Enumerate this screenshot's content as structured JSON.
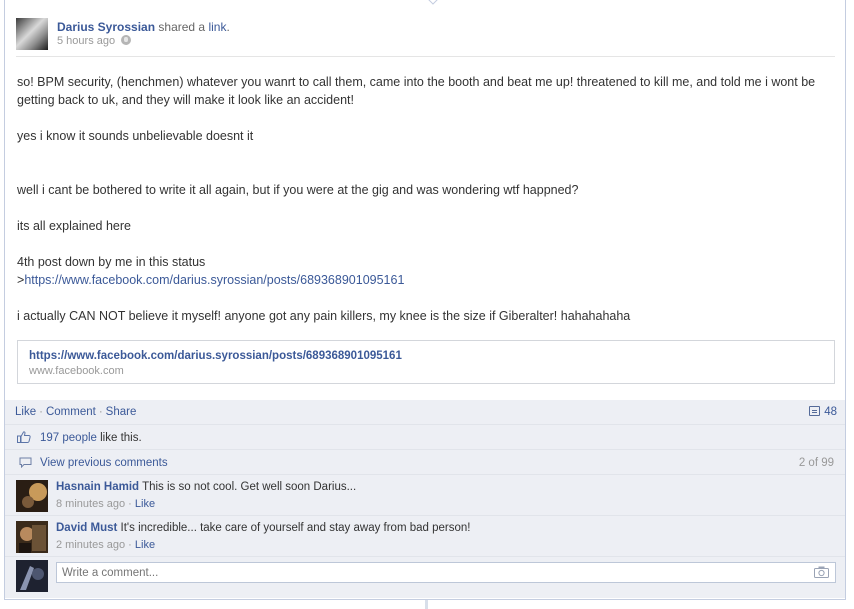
{
  "post": {
    "author": "Darius Syrossian",
    "action": "shared a",
    "action_link": "link",
    "action_end": ".",
    "time": "5 hours ago",
    "paragraphs": [
      "so! BPM security, (henchmen) whatever you wanrt to call them, came into the booth and beat me up! threatened to kill me, and told me i wont be getting back to uk, and they will make it look like an accident!",
      "",
      "yes i know it sounds unbelievable doesnt it",
      "",
      "",
      "well i cant be bothered to write it all again, but if you were at the gig and was wondering wtf happned?",
      "",
      "its all explained here",
      "",
      "4th post down by me in this status"
    ],
    "link_prefix": ">",
    "link_url": "https://www.facebook.com/darius.syrossian/posts/689368901095161",
    "closing": "i actually CAN NOT believe it myself! anyone got any pain killers, my knee is the size if Giberalter! hahahahaha"
  },
  "share": {
    "title": "https://www.facebook.com/darius.syrossian/posts/689368901095161",
    "domain": "www.facebook.com"
  },
  "actions": {
    "like": "Like",
    "separator": "·",
    "comment": "Comment",
    "share": "Share",
    "comment_count": "48"
  },
  "likes": {
    "people": "197 people",
    "suffix": " like this."
  },
  "previous": {
    "label": "View previous comments",
    "count": "2 of 99"
  },
  "comments": [
    {
      "name": "Hasnain Hamid",
      "text": "This is so not cool. Get well soon Darius...",
      "time": "8 minutes ago",
      "like": "Like"
    },
    {
      "name": "David Must",
      "text": "It's incredible... take care of yourself and stay away from bad person!",
      "time": "2 minutes ago",
      "like": "Like"
    }
  ],
  "composer": {
    "placeholder": "Write a comment..."
  },
  "colors": {
    "link": "#3b5998",
    "feedback_bg": "#edeff4",
    "border": "#c4cde0"
  }
}
